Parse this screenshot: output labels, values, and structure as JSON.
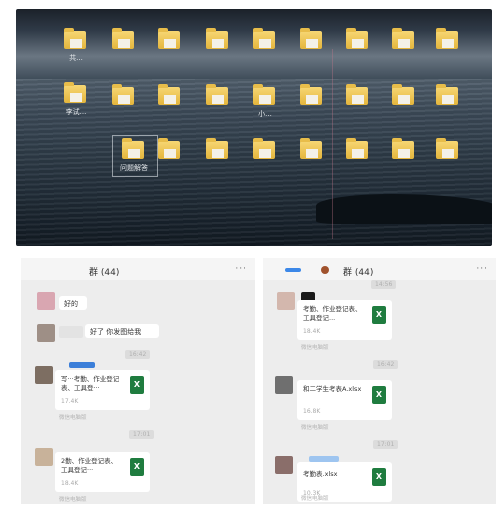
{
  "desktop": {
    "labels": {
      "r1c1": "共...",
      "r2c1": "李试...",
      "r2c5": "小...",
      "r3c2": "问题解答"
    }
  },
  "chat_left": {
    "title": "群 (44)",
    "more": "···",
    "messages": {
      "m1_text": "好的",
      "m2_text": "好了 你发图给我",
      "file1_name": "写···考勤、作业登记表、工具登···",
      "file1_size": "17.4K",
      "file1_src": "微信电脑版",
      "file2_name": "2勤、作业登记表、工具登记···",
      "file2_size": "18.4K",
      "file2_src": "微信电脑版"
    },
    "timestamps": {
      "t1": "16:42",
      "t2": "17:01"
    }
  },
  "chat_right": {
    "title": "群 (44)",
    "more": "···",
    "messages": {
      "file1_name": "考勤、作业登记表、工具登记...",
      "file1_size": "18.4K",
      "file1_src": "微信电脑版",
      "file2_name": "和二学生考表A.xlsx",
      "file2_size": "16.8K",
      "file2_src": "微信电脑版",
      "file3_name": "考勤表.xlsx",
      "file3_size": "10.3K",
      "file3_src": "微信电脑版"
    },
    "timestamps": {
      "t0": "14:56",
      "t1": "16:42",
      "t2": "17:01"
    }
  },
  "file_icon_glyph": "X",
  "colors": {
    "xls": "#1f7c3f",
    "folder": "#f0c95a",
    "chat_bg": "#ededed"
  }
}
